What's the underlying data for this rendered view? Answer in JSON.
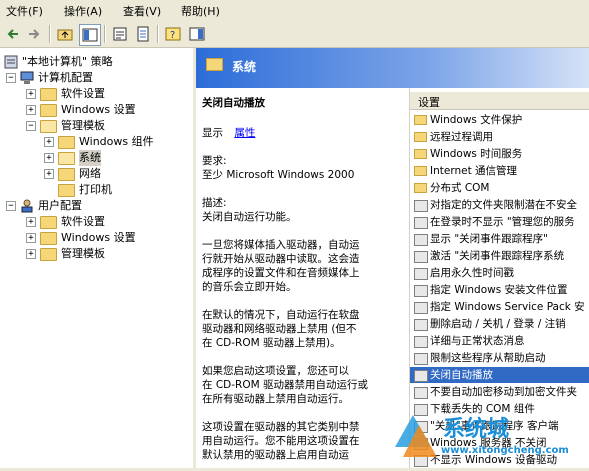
{
  "menu": {
    "file": "文件(F)",
    "action": "操作(A)",
    "view": "查看(V)",
    "help": "帮助(H)"
  },
  "toolbar": {
    "icons": [
      "back-arrow-icon",
      "forward-arrow-icon",
      "up-folder-icon",
      "show-hide-tree-icon",
      "properties-icon",
      "export-list-icon",
      "help-icon",
      "show-hide-action-pane-icon"
    ]
  },
  "tree": {
    "root": "\"本地计算机\" 策略",
    "computer_config": "计算机配置",
    "cc_software": "软件设置",
    "cc_windows": "Windows 设置",
    "cc_admin": "管理模板",
    "cc_admin_components": "Windows 组件",
    "cc_admin_system": "系统",
    "cc_admin_network": "网络",
    "cc_admin_printers": "打印机",
    "user_config": "用户配置",
    "uc_software": "软件设置",
    "uc_windows": "Windows 设置",
    "uc_admin": "管理模板"
  },
  "header": {
    "title": "系统"
  },
  "description": {
    "title": "关闭自动播放",
    "show_label": "显示",
    "properties_link": "属性",
    "requirements_label": "要求:",
    "requirements_value": "至少 Microsoft Windows 2000",
    "desc_label": "描述:",
    "desc_line1": "关闭自动运行功能。",
    "para1_l1": "一旦您将媒体插入驱动器，自动运",
    "para1_l2": "行就开始从驱动器中读取。这会造",
    "para1_l3": "成程序的设置文件和在音频媒体上",
    "para1_l4": "的音乐会立即开始。",
    "para2_l1": "在默认的情况下，自动运行在软盘",
    "para2_l2": "驱动器和网络驱动器上禁用 (但不",
    "para2_l3": "在 CD-ROM 驱动器上禁用)。",
    "para3_l1": "如果您启动这项设置，您还可以",
    "para3_l2": "在 CD-ROM 驱动器禁用自动运行或",
    "para3_l3": "在所有驱动器上禁用自动运行。",
    "para4_l1": "这项设置在驱动器的其它类别中禁",
    "para4_l2": "用自动运行。您不能用这项设置在",
    "para4_l3": "默认禁用的驱动器上启用自动运"
  },
  "list": {
    "column": "设置",
    "rows": [
      {
        "type": "folder",
        "label": "Windows 文件保护"
      },
      {
        "type": "folder",
        "label": "远程过程调用"
      },
      {
        "type": "folder",
        "label": "Windows 时间服务"
      },
      {
        "type": "folder",
        "label": "Internet 通信管理"
      },
      {
        "type": "folder",
        "label": "分布式 COM"
      },
      {
        "type": "setting",
        "label": "对指定的文件夹限制潜在不安全"
      },
      {
        "type": "setting",
        "label": "在登录时不显示 \"管理您的服务"
      },
      {
        "type": "setting",
        "label": "显示 \"关闭事件跟踪程序\""
      },
      {
        "type": "setting",
        "label": "激活 \"关闭事件跟踪程序系统"
      },
      {
        "type": "setting",
        "label": "启用永久性时间戳"
      },
      {
        "type": "setting",
        "label": "指定 Windows 安装文件位置"
      },
      {
        "type": "setting",
        "label": "指定 Windows Service Pack 安"
      },
      {
        "type": "setting",
        "label": "删除启动 / 关机 / 登录 / 注销"
      },
      {
        "type": "setting",
        "label": "详细与正常状态消息"
      },
      {
        "type": "setting",
        "label": "限制这些程序从帮助启动"
      },
      {
        "type": "setting",
        "label": "关闭自动播放"
      },
      {
        "type": "setting",
        "label": "不要自动加密移动到加密文件夹"
      },
      {
        "type": "setting",
        "label": "下载丢失的 COM 组件"
      },
      {
        "type": "setting",
        "label": "\"关机\"事件跟踪程序 客户端"
      },
      {
        "type": "setting",
        "label": "Windows 服务器 不关闭"
      },
      {
        "type": "setting",
        "label": "不显示 Windows 设备驱动"
      }
    ],
    "selected_index": 15
  },
  "watermark": {
    "brand": "系统城",
    "url": "www.xitongcheng.com"
  },
  "colors": {
    "selection": "#316ac5",
    "header_start": "#2c6cd8",
    "link": "#0000ff"
  }
}
